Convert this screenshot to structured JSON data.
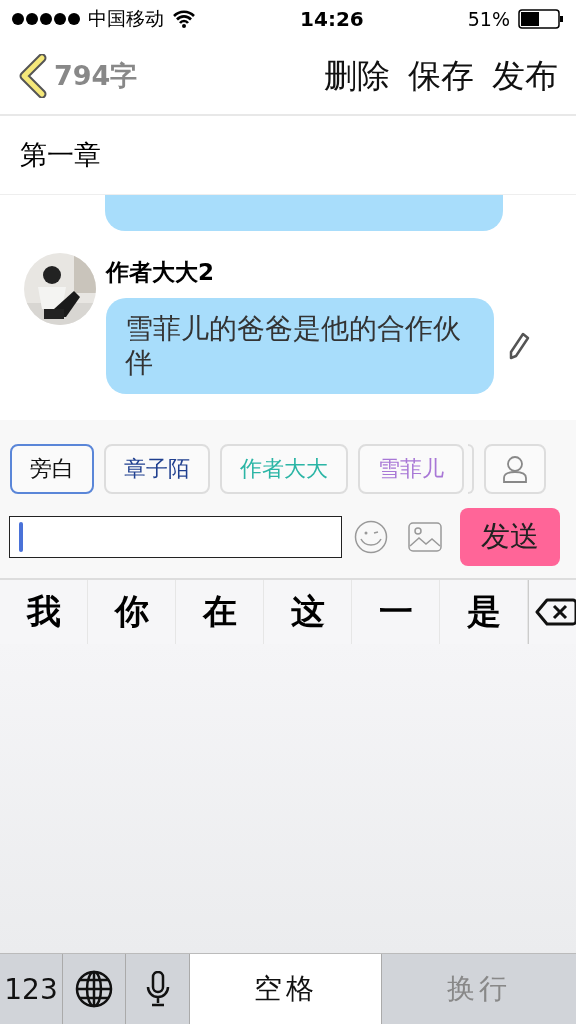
{
  "status_bar": {
    "carrier": "中国移动",
    "time": "14:26",
    "battery": "51%"
  },
  "nav": {
    "word_count": "794字",
    "actions": [
      "删除",
      "保存",
      "发布"
    ]
  },
  "chapter_title": "第一章",
  "messages": [
    {
      "kind": "cut"
    },
    {
      "kind": "full",
      "author": "作者大大2",
      "text": "雪菲儿的爸爸是他的合作伙伴"
    }
  ],
  "characters": [
    {
      "label": "旁白",
      "selected": true,
      "color": "#111111"
    },
    {
      "label": "章子陌",
      "selected": false,
      "color": "#1f3f8f"
    },
    {
      "label": "作者大大",
      "selected": false,
      "color": "#2bb5a5"
    },
    {
      "label": "雪菲儿",
      "selected": false,
      "color": "#a877d6"
    }
  ],
  "send_button": "发送",
  "candidates": [
    "我",
    "你",
    "在",
    "这",
    "一",
    "是"
  ],
  "keyboard": {
    "numbers_key": "123",
    "space_key": "空格",
    "return_key": "换行",
    "return_disabled": true
  }
}
